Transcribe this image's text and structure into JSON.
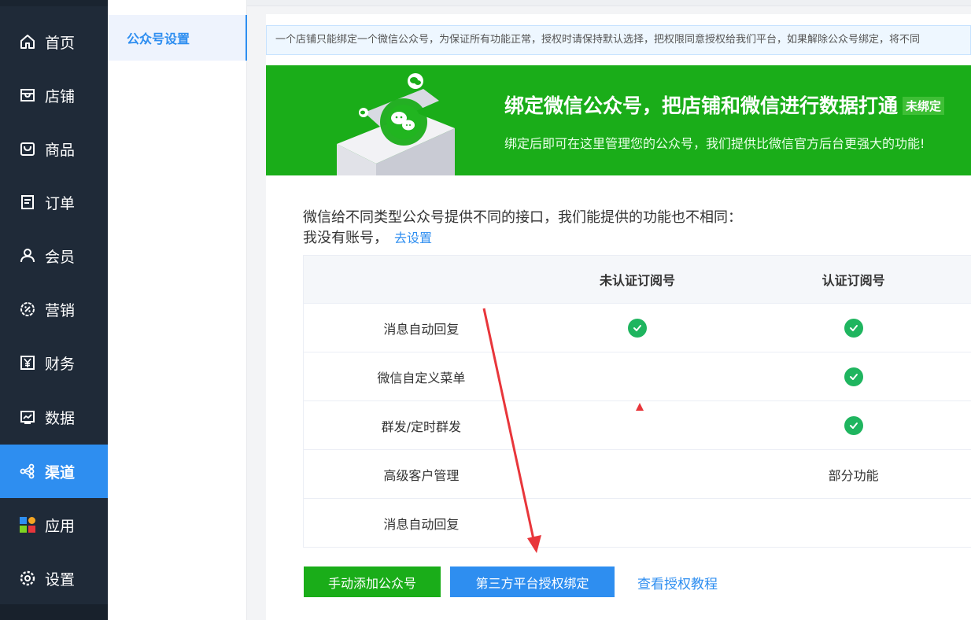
{
  "nav": {
    "items": [
      {
        "label": "首页",
        "icon": "home-icon",
        "active": false
      },
      {
        "label": "店铺",
        "icon": "store-icon",
        "active": false
      },
      {
        "label": "商品",
        "icon": "shopping-bag-icon",
        "active": false
      },
      {
        "label": "订单",
        "icon": "order-list-icon",
        "active": false
      },
      {
        "label": "会员",
        "icon": "user-icon",
        "active": false
      },
      {
        "label": "营销",
        "icon": "discount-icon",
        "active": false
      },
      {
        "label": "财务",
        "icon": "yen-icon",
        "active": false
      },
      {
        "label": "数据",
        "icon": "chart-icon",
        "active": false
      },
      {
        "label": "渠道",
        "icon": "share-icon",
        "active": true
      },
      {
        "label": "应用",
        "icon": "apps-icon",
        "active": false
      },
      {
        "label": "设置",
        "icon": "gear-icon",
        "active": false
      }
    ]
  },
  "subnav": {
    "active_label": "公众号设置"
  },
  "notice": {
    "text": "一个店铺只能绑定一个微信公众号，为保证所有功能正常，授权时请保持默认选择，把权限同意授权给我们平台，如果解除公众号绑定，将不同"
  },
  "banner": {
    "title": "绑定微信公众号，把店铺和微信进行数据打通",
    "badge": "未绑定",
    "subtitle": "绑定后即可在这里管理您的公众号，我们提供比微信官方后台更强大的功能!",
    "colors": {
      "bg": "#1aad19"
    }
  },
  "intro": {
    "line1": "微信给不同类型公众号提供不同的接口，我们能提供的功能也不相同：",
    "line2": "我没有账号，",
    "setup_link": "去设置"
  },
  "table": {
    "headers": [
      "",
      "未认证订阅号",
      "认证订阅号"
    ],
    "rows": [
      {
        "feature": "消息自动回复",
        "unverified": "check",
        "verified": "check"
      },
      {
        "feature": "微信自定义菜单",
        "unverified": "",
        "verified": "check"
      },
      {
        "feature": "群发/定时群发",
        "unverified": "",
        "verified": "check"
      },
      {
        "feature": "高级客户管理",
        "unverified": "",
        "verified": "部分功能"
      },
      {
        "feature": "消息自动回复",
        "unverified": "",
        "verified": ""
      }
    ]
  },
  "actions": {
    "manual_add": "手动添加公众号",
    "third_party_auth": "第三方平台授权绑定",
    "tutorial_link": "查看授权教程"
  },
  "colors": {
    "accent": "#2e8ef0",
    "green": "#1aad19",
    "nav_bg": "#1f2a38",
    "check": "#1fb55f",
    "arrow": "#e8363b"
  }
}
